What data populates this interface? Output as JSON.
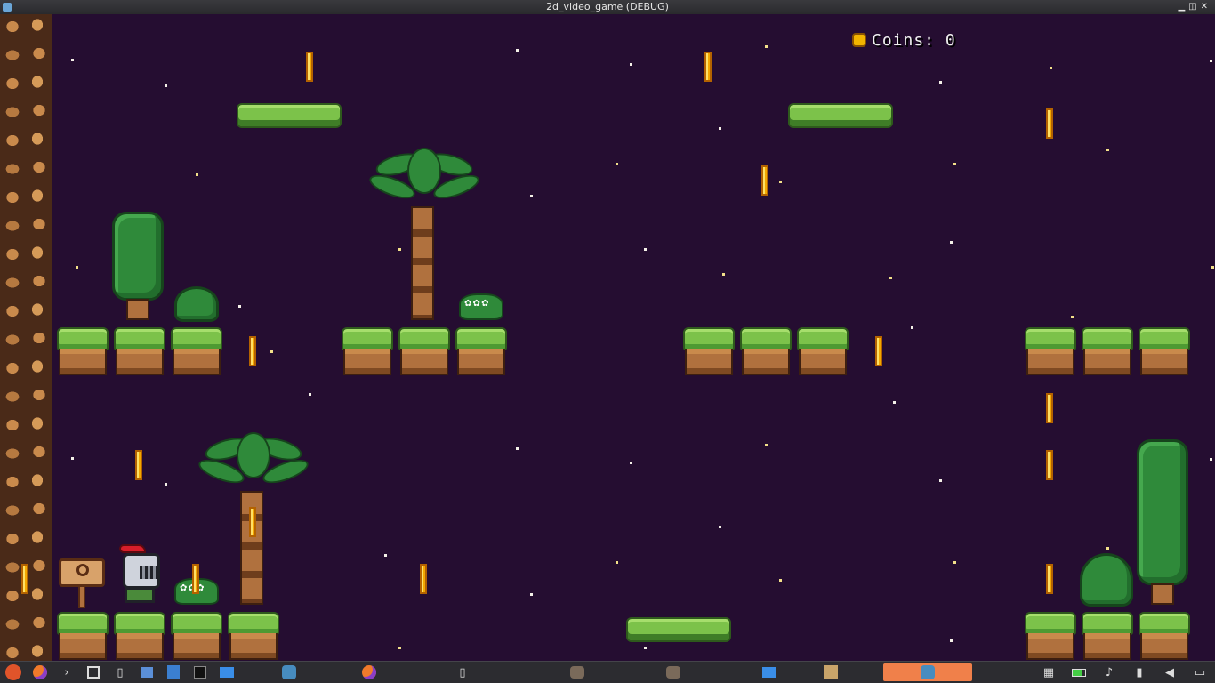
{
  "window": {
    "title": "2d_video_game (DEBUG)",
    "controls": [
      "minimize",
      "restore",
      "close"
    ]
  },
  "hud": {
    "coins_text": "Coins: 0",
    "icon": "coin-icon"
  },
  "game": {
    "player": "knight",
    "background_color": "#250d31",
    "coin_color": "#f3a800",
    "grass_color": "#7cc24a"
  },
  "taskbar": {
    "launchers": [
      "start-menu-icon",
      "firefox-icon",
      "terminal-icon",
      "notes-icon",
      "app-icon",
      "screenshot-icon",
      "editor-icon",
      "inkscape-icon",
      "files-icon",
      "godot-icon",
      "firefox-icon",
      "phone-icon"
    ],
    "tasks": [
      "gimp-icon",
      "gimp-icon",
      "files-icon",
      "archive-icon",
      "godot-icon"
    ],
    "active_task_index": 4,
    "tray": [
      "network-icon",
      "battery-icon",
      "notification-icon",
      "usb-icon",
      "volume-icon",
      "desktop-icon"
    ]
  }
}
